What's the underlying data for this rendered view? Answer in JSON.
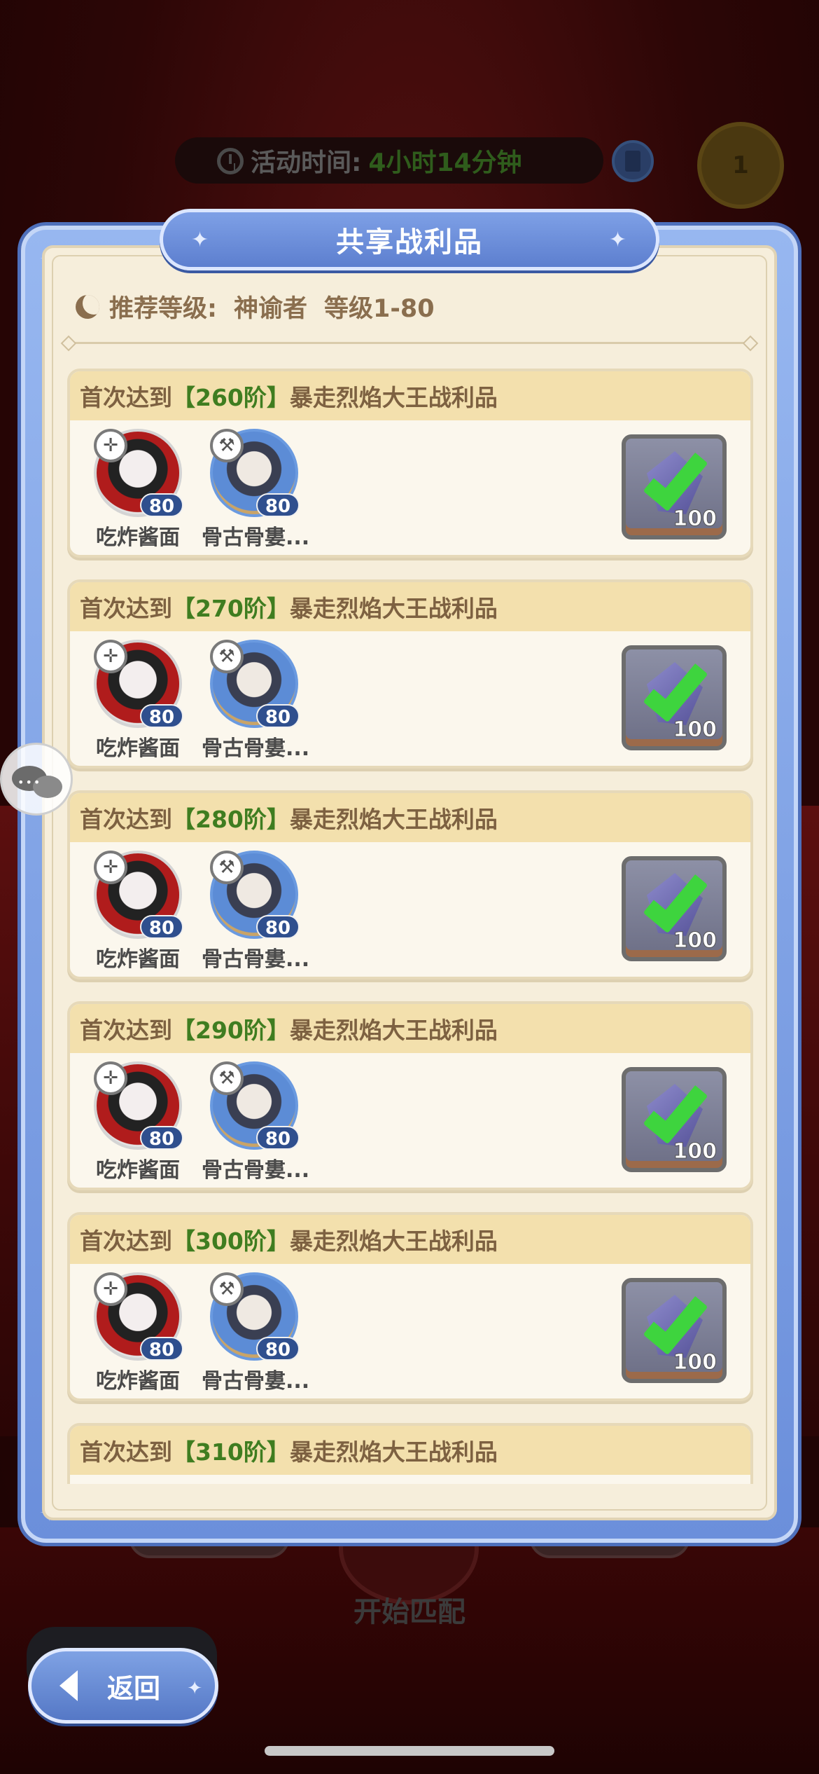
{
  "header": {
    "timer_label": "活动时间:",
    "timer_value": "4小时14分钟"
  },
  "dialog": {
    "title": "共享战利品",
    "recommended_label": "推荐等级:",
    "recommended_class": "神谕者",
    "recommended_range": "等级1-80"
  },
  "rewards": [
    {
      "prefix": "首次达到",
      "tier": "【260阶】",
      "suffix": "暴走烈焰大王战利品",
      "heroes": [
        {
          "name": "吃炸酱面",
          "level": "80"
        },
        {
          "name": "骨古骨婁...",
          "level": "80"
        }
      ],
      "item_count": "100",
      "claimed": true
    },
    {
      "prefix": "首次达到",
      "tier": "【270阶】",
      "suffix": "暴走烈焰大王战利品",
      "heroes": [
        {
          "name": "吃炸酱面",
          "level": "80"
        },
        {
          "name": "骨古骨婁...",
          "level": "80"
        }
      ],
      "item_count": "100",
      "claimed": true
    },
    {
      "prefix": "首次达到",
      "tier": "【280阶】",
      "suffix": "暴走烈焰大王战利品",
      "heroes": [
        {
          "name": "吃炸酱面",
          "level": "80"
        },
        {
          "name": "骨古骨婁...",
          "level": "80"
        }
      ],
      "item_count": "100",
      "claimed": true
    },
    {
      "prefix": "首次达到",
      "tier": "【290阶】",
      "suffix": "暴走烈焰大王战利品",
      "heroes": [
        {
          "name": "吃炸酱面",
          "level": "80"
        },
        {
          "name": "骨古骨婁...",
          "level": "80"
        }
      ],
      "item_count": "100",
      "claimed": true
    },
    {
      "prefix": "首次达到",
      "tier": "【300阶】",
      "suffix": "暴走烈焰大王战利品",
      "heroes": [
        {
          "name": "吃炸酱面",
          "level": "80"
        },
        {
          "name": "骨古骨婁...",
          "level": "80"
        }
      ],
      "item_count": "100",
      "claimed": true
    },
    {
      "prefix": "首次达到",
      "tier": "【310阶】",
      "suffix": "暴走烈焰大王战利品",
      "heroes": [],
      "item_count": "",
      "claimed": false
    }
  ],
  "background": {
    "match_label": "开始匹配"
  },
  "footer": {
    "back_label": "返回"
  },
  "colors": {
    "accent_blue": "#6b8fdb",
    "tier_green": "#3f7d20",
    "check_green": "#3ed43e",
    "card_header": "#f3e0ad"
  },
  "icons": [
    "clock-icon",
    "book-icon",
    "trophy-icon",
    "chat-icon",
    "moon-icon",
    "crystal-icon",
    "check-icon",
    "back-chevron-icon"
  ]
}
